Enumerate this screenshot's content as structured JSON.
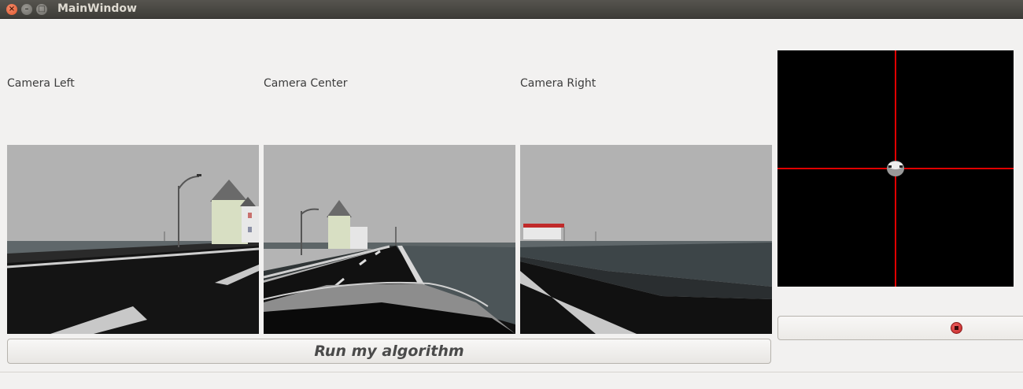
{
  "window": {
    "title": "MainWindow",
    "close_glyph": "×",
    "minimize_glyph": "–",
    "maximize_glyph": "□"
  },
  "cameras": {
    "left": {
      "label": "Camera Left"
    },
    "center": {
      "label": "Camera Center"
    },
    "right": {
      "label": "Camera Right"
    }
  },
  "map": {
    "background_color": "#000000",
    "crosshair_color": "#e00000"
  },
  "controls": {
    "run_label": "Run my algorithm",
    "joystick_color": "#d33030"
  }
}
